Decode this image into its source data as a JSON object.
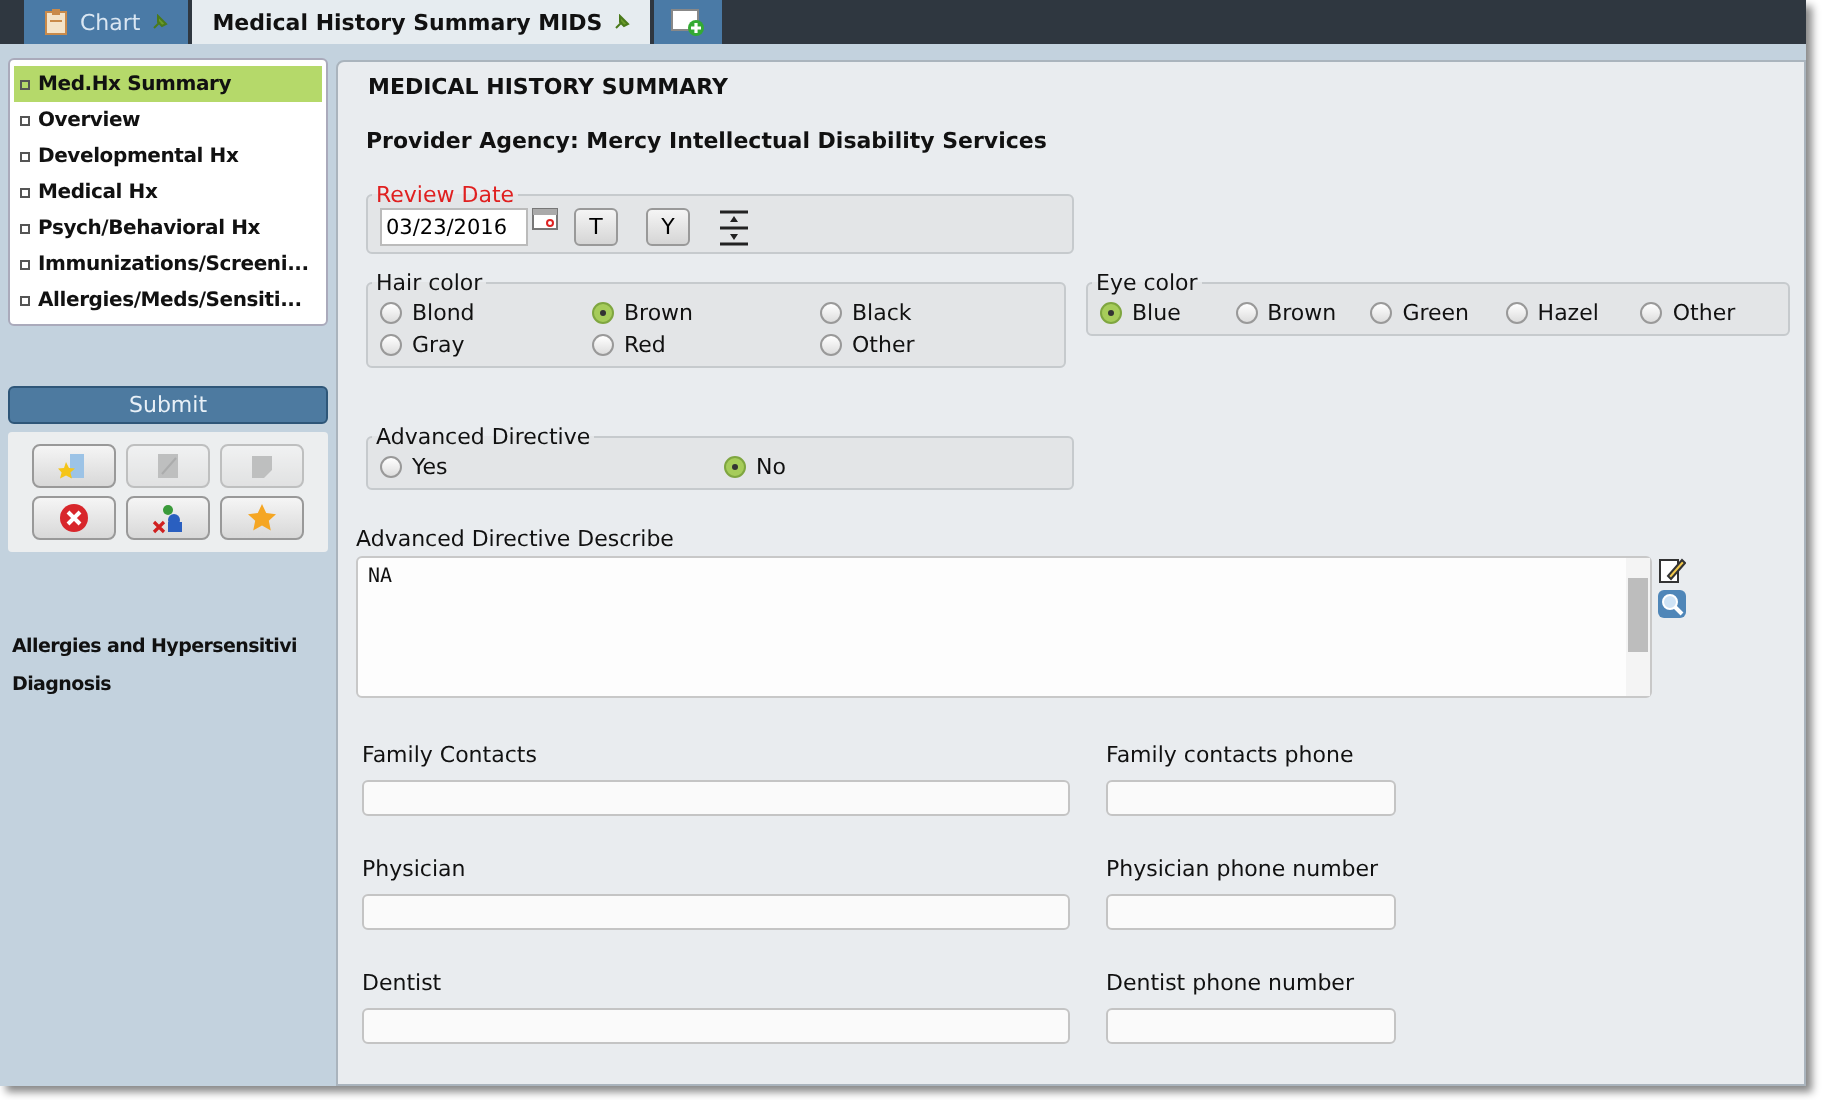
{
  "tabs": [
    {
      "kind": "chart",
      "label": "Chart",
      "selected": false
    },
    {
      "kind": "document",
      "label": "Medical History Summary MIDS",
      "selected": true
    },
    {
      "kind": "add",
      "selected": false
    }
  ],
  "sidebar": {
    "nav": [
      {
        "label": "Med.Hx Summary",
        "selected": true
      },
      {
        "label": "Overview",
        "selected": false
      },
      {
        "label": "Developmental Hx",
        "selected": false
      },
      {
        "label": "Medical Hx",
        "selected": false
      },
      {
        "label": "Psych/Behavioral Hx",
        "selected": false
      },
      {
        "label": "Immunizations/Screeni...",
        "selected": false
      },
      {
        "label": "Allergies/Meds/Sensiti...",
        "selected": false
      }
    ],
    "submit": "Submit",
    "tools": [
      {
        "kind": "bookmark",
        "disabled": false
      },
      {
        "kind": "edit",
        "disabled": true
      },
      {
        "kind": "note",
        "disabled": true
      },
      {
        "kind": "cancel",
        "disabled": false
      },
      {
        "kind": "users",
        "disabled": false
      },
      {
        "kind": "star",
        "disabled": false
      }
    ],
    "links": [
      "Allergies and Hypersensitivi",
      "Diagnosis"
    ]
  },
  "main": {
    "title": "MEDICAL HISTORY SUMMARY",
    "provider": "Provider Agency: Mercy Intellectual Disability Services",
    "review_date": {
      "label": "Review Date",
      "value": "03/23/2016",
      "buttons": [
        "T",
        "Y"
      ]
    },
    "hair_color": {
      "legend": "Hair color",
      "options": [
        {
          "label": "Blond",
          "selected": false
        },
        {
          "label": "Brown",
          "selected": true
        },
        {
          "label": "Black",
          "selected": false
        },
        {
          "label": "Gray",
          "selected": false
        },
        {
          "label": "Red",
          "selected": false
        },
        {
          "label": "Other",
          "selected": false
        }
      ]
    },
    "eye_color": {
      "legend": "Eye color",
      "options": [
        {
          "label": "Blue",
          "selected": true
        },
        {
          "label": "Brown",
          "selected": false
        },
        {
          "label": "Green",
          "selected": false
        },
        {
          "label": "Hazel",
          "selected": false
        },
        {
          "label": "Other",
          "selected": false
        }
      ]
    },
    "advanced_directive": {
      "legend": "Advanced Directive",
      "options": [
        {
          "label": "Yes",
          "selected": false
        },
        {
          "label": "No",
          "selected": true
        }
      ]
    },
    "describe": {
      "label": "Advanced Directive Describe",
      "value": "NA"
    },
    "contacts": [
      {
        "name": "Family Contacts",
        "phone": "Family contacts phone"
      },
      {
        "name": "Physician",
        "phone": "Physician phone number"
      },
      {
        "name": "Dentist",
        "phone": "Dentist phone number"
      }
    ]
  }
}
